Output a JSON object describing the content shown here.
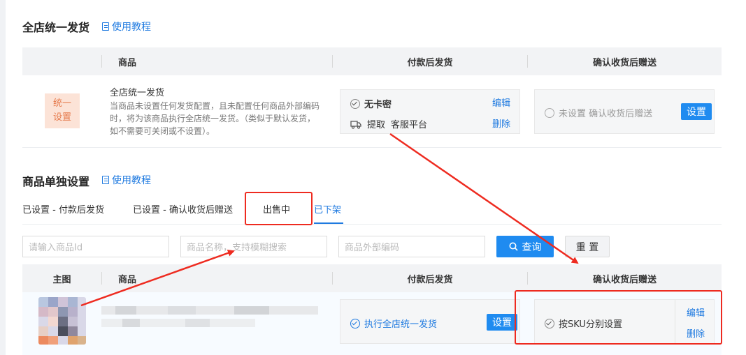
{
  "section1": {
    "title": "全店统一发货",
    "tutorial": "使用教程",
    "table_headers": [
      "商品",
      "付款后发货",
      "确认收货后赠送"
    ],
    "badge_line1": "统一",
    "badge_line2": "设置",
    "item_title": "全店统一发货",
    "item_desc_lines": [
      "当商品未设置任何发货配置，且未配置任何商品外部编码",
      "时，将为该商品执行全店统一发货。（类似于默认发货，",
      "如不需要可关闭或不设置）。"
    ],
    "pay_status": "无卡密",
    "pay_extract": "提取",
    "pay_platform": "客服平台",
    "edit": "编辑",
    "delete": "删除",
    "gift_status": "未设置 确认收货后赠送",
    "gift_button": "设置"
  },
  "section2": {
    "title": "商品单独设置",
    "tutorial": "使用教程",
    "tabs": [
      "已设置 - 付款后发货",
      "已设置 - 确认收货后赠送",
      "出售中",
      "已下架"
    ],
    "active_tab_index": 3,
    "search": {
      "id_placeholder": "请输入商品Id",
      "name_placeholder": "商品名称，支持模糊搜索",
      "code_placeholder": "商品外部编码",
      "query_button": "查询",
      "reset_button": "重 置"
    },
    "table_headers": [
      "主图",
      "商品",
      "付款后发货",
      "确认收货后赠送"
    ],
    "row": {
      "pay_status": "执行全店统一发货",
      "pay_button": "设置",
      "gift_status": "按SKU分别设置",
      "edit": "编辑",
      "delete": "删除"
    }
  },
  "colors": {
    "accent": "#1f7ae0",
    "annotation_red": "#ee2b20",
    "badge_bg": "#fce3d7",
    "badge_text": "#e5784a"
  }
}
